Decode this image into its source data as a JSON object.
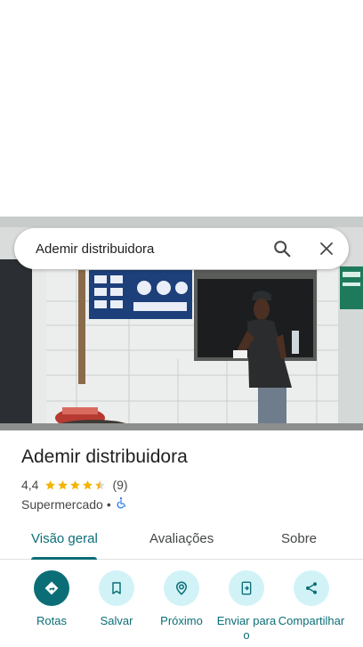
{
  "search": {
    "query": "Ademir distribuidora"
  },
  "place": {
    "name": "Ademir distribuidora",
    "rating": "4,4",
    "rating_value": 4.4,
    "review_count": "(9)",
    "category": "Supermercado",
    "separator": "•"
  },
  "tabs": [
    {
      "label": "Visão geral",
      "active": true
    },
    {
      "label": "Avaliações",
      "active": false
    },
    {
      "label": "Sobre",
      "active": false
    }
  ],
  "actions": [
    {
      "label": "Rotas",
      "icon": "directions-icon"
    },
    {
      "label": "Salvar",
      "icon": "bookmark-icon"
    },
    {
      "label": "Próximo",
      "icon": "nearby-icon"
    },
    {
      "label": "Enviar para o",
      "icon": "send-to-phone-icon"
    },
    {
      "label": "Compartilhar",
      "icon": "share-icon"
    }
  ],
  "colors": {
    "accent": "#0b6e76",
    "action_bg": "#d1f3f7",
    "star": "#f4b400",
    "accessible": "#1a73e8"
  }
}
